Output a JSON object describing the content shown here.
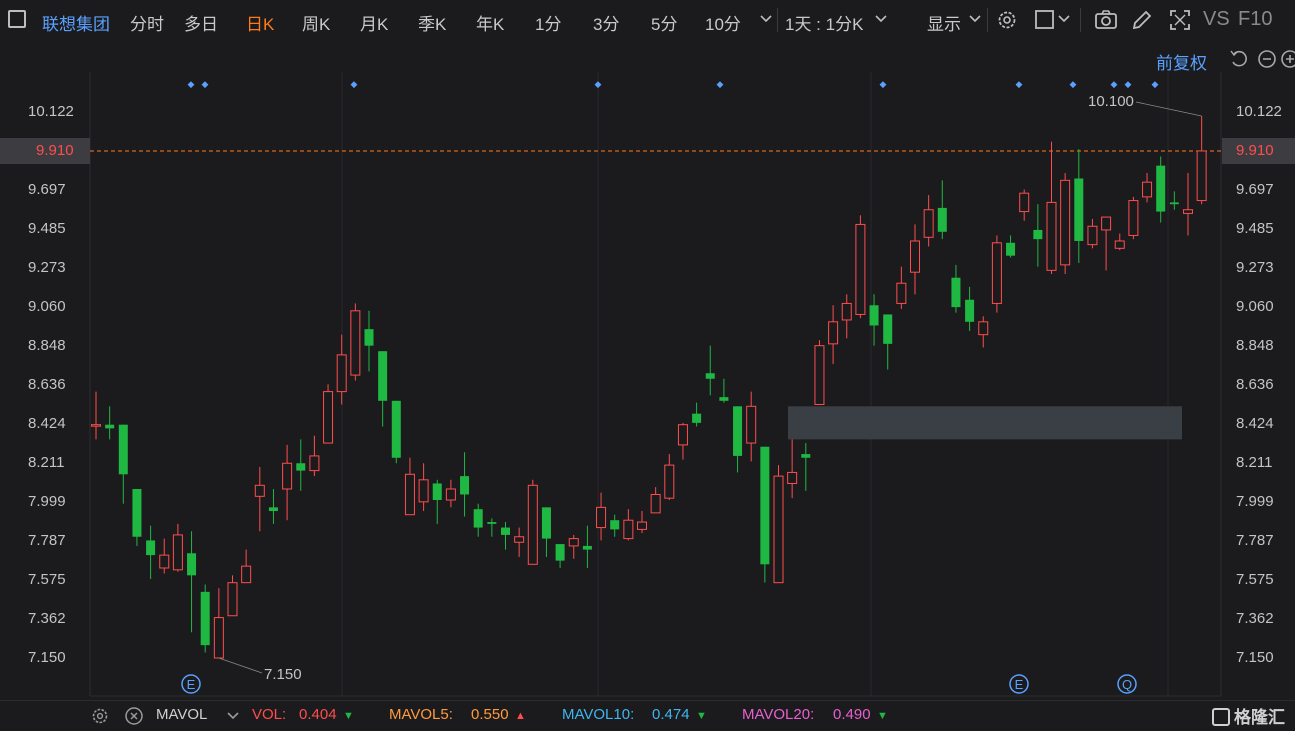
{
  "toolbar": {
    "stock_name": "联想集团",
    "tabs": [
      "分时",
      "多日",
      "日K",
      "周K",
      "月K",
      "季K",
      "年K",
      "1分",
      "3分",
      "5分",
      "10分"
    ],
    "active_tab": "日K",
    "period_select": "1天 : 1分K",
    "display_label": "显示",
    "vs_label": "VS",
    "f10_label": "F10"
  },
  "adjust_label": "前复权",
  "colors": {
    "up": "#ff4d4d",
    "down": "#1fb843",
    "current_line": "#ff7a1a",
    "accent": "#5aa0ff",
    "background": "#1b1b1d"
  },
  "chart_data": {
    "type": "candlestick",
    "y_ticks": [
      "10.122",
      "9.910",
      "9.697",
      "9.485",
      "9.273",
      "9.060",
      "8.848",
      "8.636",
      "8.424",
      "8.211",
      "7.999",
      "7.787",
      "7.575",
      "7.362",
      "7.150"
    ],
    "current_price": "9.910",
    "current_price_value": 9.91,
    "high_label": "10.100",
    "low_label": "7.150",
    "ylim": [
      7.15,
      10.122
    ],
    "candles": [
      {
        "o": 8.42,
        "c": 8.42,
        "h": 8.6,
        "l": 8.34
      },
      {
        "o": 8.42,
        "c": 8.4,
        "h": 8.52,
        "l": 8.34
      },
      {
        "o": 8.42,
        "c": 8.15,
        "h": 8.42,
        "l": 7.99
      },
      {
        "o": 8.07,
        "c": 7.81,
        "h": 8.07,
        "l": 7.76
      },
      {
        "o": 7.79,
        "c": 7.71,
        "h": 7.87,
        "l": 7.58
      },
      {
        "o": 7.64,
        "c": 7.71,
        "h": 7.8,
        "l": 7.61
      },
      {
        "o": 7.63,
        "c": 7.82,
        "h": 7.88,
        "l": 7.62
      },
      {
        "o": 7.72,
        "c": 7.6,
        "h": 7.84,
        "l": 7.29
      },
      {
        "o": 7.51,
        "c": 7.22,
        "h": 7.55,
        "l": 7.18
      },
      {
        "o": 7.15,
        "c": 7.37,
        "h": 7.53,
        "l": 7.15
      },
      {
        "o": 7.38,
        "c": 7.56,
        "h": 7.6,
        "l": 7.38
      },
      {
        "o": 7.56,
        "c": 7.65,
        "h": 7.74,
        "l": 7.56
      },
      {
        "o": 8.03,
        "c": 8.09,
        "h": 8.19,
        "l": 7.84
      },
      {
        "o": 7.97,
        "c": 7.95,
        "h": 8.07,
        "l": 7.88
      },
      {
        "o": 8.07,
        "c": 8.21,
        "h": 8.31,
        "l": 7.9
      },
      {
        "o": 8.21,
        "c": 8.17,
        "h": 8.34,
        "l": 8.06
      },
      {
        "o": 8.17,
        "c": 8.25,
        "h": 8.36,
        "l": 8.14
      },
      {
        "o": 8.32,
        "c": 8.6,
        "h": 8.64,
        "l": 8.32
      },
      {
        "o": 8.6,
        "c": 8.8,
        "h": 8.91,
        "l": 8.53
      },
      {
        "o": 8.69,
        "c": 9.04,
        "h": 9.08,
        "l": 8.66
      },
      {
        "o": 8.94,
        "c": 8.85,
        "h": 9.04,
        "l": 8.71
      },
      {
        "o": 8.82,
        "c": 8.55,
        "h": 8.82,
        "l": 8.41
      },
      {
        "o": 8.55,
        "c": 8.24,
        "h": 8.55,
        "l": 8.21
      },
      {
        "o": 7.93,
        "c": 8.15,
        "h": 8.24,
        "l": 7.93
      },
      {
        "o": 8.0,
        "c": 8.12,
        "h": 8.21,
        "l": 7.95
      },
      {
        "o": 8.1,
        "c": 8.01,
        "h": 8.12,
        "l": 7.88
      },
      {
        "o": 8.01,
        "c": 8.07,
        "h": 8.12,
        "l": 7.97
      },
      {
        "o": 8.14,
        "c": 8.04,
        "h": 8.27,
        "l": 7.92
      },
      {
        "o": 7.96,
        "c": 7.86,
        "h": 7.99,
        "l": 7.81
      },
      {
        "o": 7.89,
        "c": 7.88,
        "h": 7.91,
        "l": 7.81
      },
      {
        "o": 7.86,
        "c": 7.82,
        "h": 7.89,
        "l": 7.74
      },
      {
        "o": 7.78,
        "c": 7.81,
        "h": 7.86,
        "l": 7.7
      },
      {
        "o": 7.66,
        "c": 8.09,
        "h": 8.12,
        "l": 7.66
      },
      {
        "o": 7.97,
        "c": 7.8,
        "h": 7.97,
        "l": 7.7
      },
      {
        "o": 7.77,
        "c": 7.68,
        "h": 7.77,
        "l": 7.64
      },
      {
        "o": 7.76,
        "c": 7.8,
        "h": 7.82,
        "l": 7.69
      },
      {
        "o": 7.76,
        "c": 7.74,
        "h": 7.87,
        "l": 7.64
      },
      {
        "o": 7.86,
        "c": 7.97,
        "h": 8.05,
        "l": 7.79
      },
      {
        "o": 7.9,
        "c": 7.85,
        "h": 7.93,
        "l": 7.81
      },
      {
        "o": 7.8,
        "c": 7.9,
        "h": 7.96,
        "l": 7.79
      },
      {
        "o": 7.85,
        "c": 7.89,
        "h": 7.95,
        "l": 7.83
      },
      {
        "o": 7.94,
        "c": 8.04,
        "h": 8.08,
        "l": 7.94
      },
      {
        "o": 8.02,
        "c": 8.2,
        "h": 8.26,
        "l": 8.01
      },
      {
        "o": 8.31,
        "c": 8.42,
        "h": 8.43,
        "l": 8.23
      },
      {
        "o": 8.48,
        "c": 8.43,
        "h": 8.54,
        "l": 8.41
      },
      {
        "o": 8.7,
        "c": 8.67,
        "h": 8.85,
        "l": 8.58
      },
      {
        "o": 8.57,
        "c": 8.55,
        "h": 8.67,
        "l": 8.54
      },
      {
        "o": 8.52,
        "c": 8.25,
        "h": 8.52,
        "l": 8.16
      },
      {
        "o": 8.32,
        "c": 8.52,
        "h": 8.6,
        "l": 8.22
      },
      {
        "o": 8.3,
        "c": 7.66,
        "h": 8.3,
        "l": 7.56
      },
      {
        "o": 7.56,
        "c": 8.14,
        "h": 8.2,
        "l": 7.56
      },
      {
        "o": 8.1,
        "c": 8.16,
        "h": 8.34,
        "l": 8.02
      },
      {
        "o": 8.26,
        "c": 8.24,
        "h": 8.32,
        "l": 8.06
      },
      {
        "o": 8.53,
        "c": 8.85,
        "h": 8.88,
        "l": 8.53
      },
      {
        "o": 8.86,
        "c": 8.98,
        "h": 9.07,
        "l": 8.75
      },
      {
        "o": 8.99,
        "c": 9.08,
        "h": 9.13,
        "l": 8.89
      },
      {
        "o": 9.02,
        "c": 9.51,
        "h": 9.56,
        "l": 9.0
      },
      {
        "o": 9.07,
        "c": 8.96,
        "h": 9.13,
        "l": 8.85
      },
      {
        "o": 9.02,
        "c": 8.86,
        "h": 9.02,
        "l": 8.72
      },
      {
        "o": 9.08,
        "c": 9.19,
        "h": 9.28,
        "l": 9.05
      },
      {
        "o": 9.25,
        "c": 9.42,
        "h": 9.51,
        "l": 9.13
      },
      {
        "o": 9.44,
        "c": 9.59,
        "h": 9.67,
        "l": 9.39
      },
      {
        "o": 9.6,
        "c": 9.47,
        "h": 9.75,
        "l": 9.43
      },
      {
        "o": 9.22,
        "c": 9.06,
        "h": 9.29,
        "l": 9.03
      },
      {
        "o": 9.1,
        "c": 8.98,
        "h": 9.17,
        "l": 8.93
      },
      {
        "o": 8.91,
        "c": 8.98,
        "h": 9.01,
        "l": 8.84
      },
      {
        "o": 9.08,
        "c": 9.41,
        "h": 9.45,
        "l": 9.03
      },
      {
        "o": 9.41,
        "c": 9.34,
        "h": 9.45,
        "l": 9.33
      },
      {
        "o": 9.58,
        "c": 9.68,
        "h": 9.7,
        "l": 9.53
      },
      {
        "o": 9.48,
        "c": 9.43,
        "h": 9.62,
        "l": 9.28
      },
      {
        "o": 9.26,
        "c": 9.63,
        "h": 9.96,
        "l": 9.24
      },
      {
        "o": 9.29,
        "c": 9.75,
        "h": 9.79,
        "l": 9.24
      },
      {
        "o": 9.76,
        "c": 9.42,
        "h": 9.92,
        "l": 9.3
      },
      {
        "o": 9.4,
        "c": 9.5,
        "h": 9.54,
        "l": 9.38
      },
      {
        "o": 9.48,
        "c": 9.55,
        "h": 9.55,
        "l": 9.26
      },
      {
        "o": 9.38,
        "c": 9.42,
        "h": 9.46,
        "l": 9.37
      },
      {
        "o": 9.45,
        "c": 9.64,
        "h": 9.66,
        "l": 9.43
      },
      {
        "o": 9.66,
        "c": 9.74,
        "h": 9.79,
        "l": 9.63
      },
      {
        "o": 9.83,
        "c": 9.58,
        "h": 9.88,
        "l": 9.52
      },
      {
        "o": 9.63,
        "c": 9.62,
        "h": 9.69,
        "l": 9.59
      },
      {
        "o": 9.57,
        "c": 9.59,
        "h": 9.79,
        "l": 9.45
      },
      {
        "o": 9.64,
        "c": 9.91,
        "h": 10.1,
        "l": 9.62
      }
    ],
    "shaded_band": {
      "from": 8.34,
      "to": 8.52
    },
    "event_markers_top": [
      "◆",
      "◆",
      "◆",
      "◆",
      "◆",
      "◆",
      "◆",
      "◆",
      "◆",
      "◆",
      "◆"
    ],
    "event_markers_bottom": [
      "E",
      "E",
      "Q"
    ]
  },
  "volume_bar": {
    "indicator": "MAVOL",
    "vol_label": "VOL:",
    "vol_value": "0.404",
    "mavol5_label": "MAVOL5:",
    "mavol5_value": "0.550",
    "mavol10_label": "MAVOL10:",
    "mavol10_value": "0.474",
    "mavol20_label": "MAVOL20:",
    "mavol20_value": "0.490"
  },
  "logo_text": "格隆汇"
}
